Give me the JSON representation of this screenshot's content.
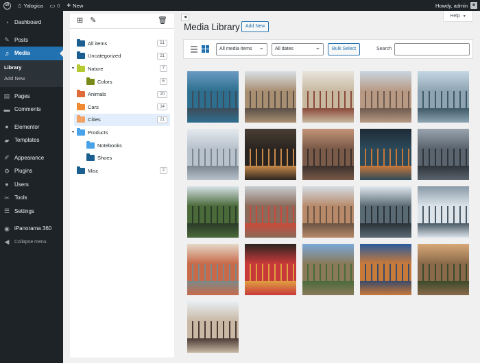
{
  "adminbar": {
    "site_name": "Yalogica",
    "comments_count": "0",
    "new_label": "New",
    "greeting": "Howdy, admin"
  },
  "sidebar": {
    "items": [
      {
        "label": "Dashboard",
        "icon": "dashboard-icon"
      },
      {
        "label": "Posts",
        "icon": "pin-icon"
      },
      {
        "label": "Media",
        "icon": "media-icon",
        "active": true
      },
      {
        "label": "Pages",
        "icon": "page-icon"
      },
      {
        "label": "Comments",
        "icon": "comment-icon"
      },
      {
        "label": "Elementor",
        "icon": "elementor-icon"
      },
      {
        "label": "Templates",
        "icon": "folder-icon"
      },
      {
        "label": "Appearance",
        "icon": "brush-icon"
      },
      {
        "label": "Plugins",
        "icon": "plug-icon"
      },
      {
        "label": "Users",
        "icon": "users-icon"
      },
      {
        "label": "Tools",
        "icon": "wrench-icon"
      },
      {
        "label": "Settings",
        "icon": "settings-icon"
      },
      {
        "label": "iPanorama 360",
        "icon": "panorama-icon"
      },
      {
        "label": "Collapse menu",
        "icon": "collapse-icon"
      }
    ],
    "media_submenu": [
      "Library",
      "Add New"
    ]
  },
  "folders": [
    {
      "name": "All items",
      "count": "51",
      "color": "#1a5f8f",
      "indent": 0
    },
    {
      "name": "Uncategorized",
      "count": "21",
      "color": "#1a5f8f",
      "indent": 0
    },
    {
      "name": "Nature",
      "count": "7",
      "color": "#b5c930",
      "indent": 0,
      "expanded": true
    },
    {
      "name": "Colors",
      "count": "6",
      "color": "#7a8a1a",
      "indent": 1
    },
    {
      "name": "Animals",
      "count": "20",
      "color": "#e06a3a",
      "indent": 0
    },
    {
      "name": "Cars",
      "count": "14",
      "color": "#f08a30",
      "indent": 0
    },
    {
      "name": "Cities",
      "count": "21",
      "color": "#f2a265",
      "indent": 0,
      "selected": true
    },
    {
      "name": "Products",
      "count": "",
      "color": "#4aa3e8",
      "indent": 0,
      "expanded": true
    },
    {
      "name": "Notebooks",
      "count": "",
      "color": "#4aa3e8",
      "indent": 1
    },
    {
      "name": "Shoes",
      "count": "",
      "color": "#1a5f8f",
      "indent": 1
    },
    {
      "name": "Misc",
      "count": "2",
      "color": "#1a5f8f",
      "indent": 0
    }
  ],
  "help_label": "Help",
  "header": {
    "title": "Media Library",
    "add_new": "Add New"
  },
  "filters": {
    "media_type": "All media items",
    "dates": "All dates",
    "bulk_select": "Bulk Select",
    "search_label": "Search",
    "search_value": ""
  },
  "thumbnails": [
    [
      "#6a9bc2",
      "#2e6f8f",
      "#3d4c5a"
    ],
    [
      "#d9dfe4",
      "#a98f72",
      "#5a5048"
    ],
    [
      "#e8e4dc",
      "#c8b8a0",
      "#8a4a3a"
    ],
    [
      "#c8d4de",
      "#b89a84",
      "#6e5a4e"
    ],
    [
      "#c4d6e2",
      "#8ea4b2",
      "#3e5a66"
    ],
    [
      "#e4eaee",
      "#b8c2cc",
      "#7a8690"
    ],
    [
      "#4a3e34",
      "#2a2420",
      "#c88a4a"
    ],
    [
      "#c49478",
      "#7a5a48",
      "#3a302c"
    ],
    [
      "#1e2a36",
      "#2c4a5a",
      "#c8783a"
    ],
    [
      "#9aa4ae",
      "#5a646e",
      "#2e343a"
    ],
    [
      "#d8e2e8",
      "#4a6a3a",
      "#2a3a28"
    ],
    [
      "#c8ccd0",
      "#8a6a5a",
      "#c84a3a"
    ],
    [
      "#d4dce4",
      "#b88a6a",
      "#6a5444"
    ],
    [
      "#e0e8ee",
      "#5a6a74",
      "#2a3238"
    ],
    [
      "#8a9aa8",
      "#dce4ea",
      "#4a5a66"
    ],
    [
      "#e4d8c8",
      "#c86a4a",
      "#7a8a8a"
    ],
    [
      "#2a2420",
      "#c83a3a",
      "#e0a040"
    ],
    [
      "#7aa8d8",
      "#8a7a5a",
      "#4a6a3a"
    ],
    [
      "#2a5a9a",
      "#c87a3a",
      "#3a4a6a"
    ],
    [
      "#d8a878",
      "#8a6a4a",
      "#3a4a2a"
    ],
    [
      "#e8eef2",
      "#c8b8a4",
      "#4a3a34"
    ]
  ]
}
